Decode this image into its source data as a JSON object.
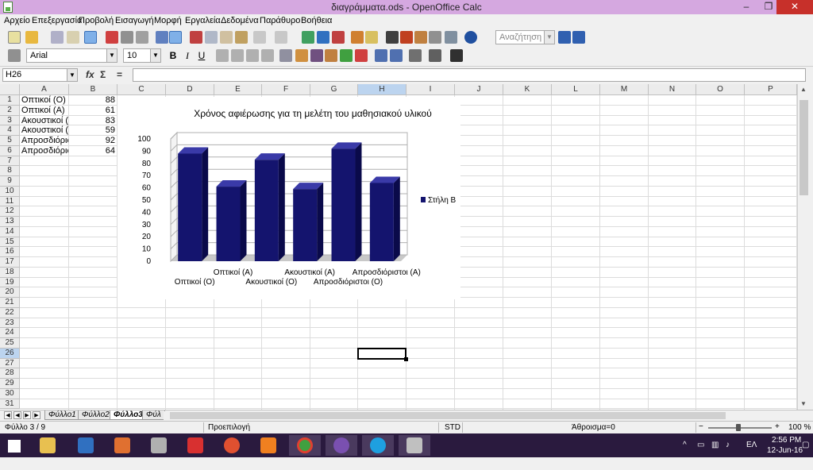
{
  "window": {
    "title": "διαγράμματα.ods - OpenOffice Calc",
    "controls": {
      "minimize": "–",
      "maximize": "❐",
      "close": "✕"
    }
  },
  "menu": [
    "Αρχείο",
    "Επεξεργασία",
    "Προβολή",
    "Εισαγωγή",
    "Μορφή",
    "Εργαλεία",
    "Δεδομένα",
    "Παράθυρο",
    "Βοήθεια"
  ],
  "toolbar": {
    "search_placeholder": "Αναζήτηση"
  },
  "formatting": {
    "font_name": "Arial",
    "font_size": "10",
    "bold": "B",
    "italic": "I",
    "underline": "U"
  },
  "formula_bar": {
    "name_box": "H26",
    "fx_label": "fx",
    "sum_label": "Σ",
    "equals_label": "=",
    "content": ""
  },
  "columns": [
    "A",
    "B",
    "C",
    "D",
    "E",
    "F",
    "G",
    "H",
    "I",
    "J",
    "K",
    "L",
    "M",
    "N",
    "O",
    "P"
  ],
  "rows": [
    "1",
    "2",
    "3",
    "4",
    "5",
    "6",
    "7",
    "8",
    "9",
    "10",
    "11",
    "12",
    "13",
    "14",
    "15",
    "16",
    "17",
    "18",
    "19",
    "20",
    "21",
    "22",
    "23",
    "24",
    "25",
    "26",
    "27",
    "28",
    "29",
    "30",
    "31"
  ],
  "active_cell": "H26",
  "cells": [
    {
      "a": "Οπτικοί (Ο)",
      "b": "88"
    },
    {
      "a": "Οπτικοί (Α)",
      "b": "61"
    },
    {
      "a": "Ακουστικοί (Ο",
      "b": "83"
    },
    {
      "a": "Ακουστικοί (Α",
      "b": "59"
    },
    {
      "a": "Απροσδιόρισ",
      "b": "92"
    },
    {
      "a": "Απροσδιόρισ",
      "b": "64"
    }
  ],
  "chart_data": {
    "type": "bar",
    "title": "Χρόνος αφιέρωσης για τη μελέτη του μαθησιακού υλικού",
    "categories": [
      "Οπτικοί (Ο)",
      "Οπτικοί (Α)",
      "Ακουστικοί (Ο)",
      "Ακουστικοί (Α)",
      "Απροσδιόριστοι (Ο)",
      "Απροσδιόριστοι (Α)"
    ],
    "series": [
      {
        "name": "Στήλη Β",
        "values": [
          88,
          61,
          83,
          59,
          92,
          64
        ]
      }
    ],
    "yticks": [
      "0",
      "10",
      "20",
      "30",
      "40",
      "50",
      "60",
      "70",
      "80",
      "90",
      "100"
    ],
    "ylim": [
      0,
      100
    ],
    "legend": "right",
    "grid": true,
    "bar_color": "#14146e",
    "bar_top_color": "#3a3aa8"
  },
  "sheet_tabs": [
    "Φύλλο1",
    "Φύλλο2",
    "Φύλλο3",
    "Φύλ"
  ],
  "active_tab": "Φύλλο3",
  "tab_nav": [
    "◀",
    "◀",
    "▶",
    "▶"
  ],
  "status": {
    "sheet": "Φύλλο 3 / 9",
    "style": "Προεπιλογή",
    "mode": "STD",
    "sum": "Άθροισμα=0",
    "zoom": "100 %",
    "zoom_minus": "−",
    "zoom_plus": "+"
  },
  "taskbar": {
    "language": "ΕΛ",
    "time": "2:56 PM",
    "date": "12-Jun-16"
  }
}
